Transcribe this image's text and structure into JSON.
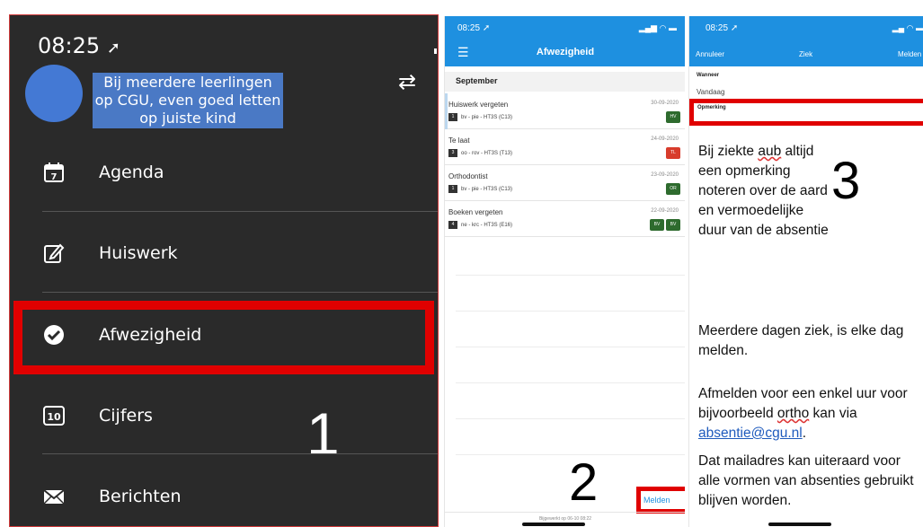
{
  "panel1": {
    "time": "08:25",
    "note": "Bij meerdere leerlingen op CGU, even goed letten op juiste kind",
    "menu": [
      {
        "label": "Agenda"
      },
      {
        "label": "Huiswerk"
      },
      {
        "label": "Afwezigheid"
      },
      {
        "label": "Cijfers"
      },
      {
        "label": "Berichten"
      }
    ],
    "cijfers_icon_text": "10",
    "agenda_icon_text": "7",
    "step": "1"
  },
  "panel2": {
    "time": "08:25",
    "title": "Afwezigheid",
    "section": "September",
    "rows": [
      {
        "title": "Huiswerk vergeten",
        "date": "30-09-2020",
        "num": "1",
        "sub": "bv - pie - HT3S (C13)",
        "badges": [
          "HV"
        ]
      },
      {
        "title": "Te laat",
        "date": "24-09-2020",
        "num": "3",
        "sub": "oo - rov - HT3S (T13)",
        "badges": [
          "TL"
        ]
      },
      {
        "title": "Orthodontist",
        "date": "23-09-2020",
        "num": "1",
        "sub": "bv - pie - HT3S (C13)",
        "badges": [
          "OR"
        ]
      },
      {
        "title": "Boeken vergeten",
        "date": "22-09-2020",
        "num": "4",
        "sub": "ne - krc - HT3S (E16)",
        "badges": [
          "BV",
          "BV"
        ]
      }
    ],
    "melden": "Melden",
    "footer": "Bijgewerkt op 06-10 08:22",
    "step": "2"
  },
  "panel3": {
    "time": "08:25",
    "cancel": "Annuleer",
    "title": "Ziek",
    "submit": "Melden",
    "wanneer_label": "Wanneer",
    "wanneer_value": "Vandaag",
    "opmerking_label": "Opmerking",
    "text1_a": "Bij ziekte ",
    "text1_b": "aub",
    "text1_c": " altijd een opmerking noteren over de aard en vermoedelijke duur van de absentie",
    "text2": "Meerdere dagen ziek, is elke dag melden.",
    "text3_a": "Afmelden voor een enkel uur voor bijvoorbeeld ",
    "text3_b": "ortho",
    "text3_c": " kan via ",
    "email": "absentie@cgu.nl",
    "text3_d": ".",
    "text4": "Dat mailadres kan uiteraard voor alle vormen van absenties gebruikt blijven worden.",
    "step": "3"
  },
  "colors": {
    "accent": "#1e90e0",
    "highlight": "#e00000",
    "dark": "#2a2a2a",
    "note": "#4a79c5",
    "green": "#2e6b2e",
    "red": "#d83c2c"
  }
}
